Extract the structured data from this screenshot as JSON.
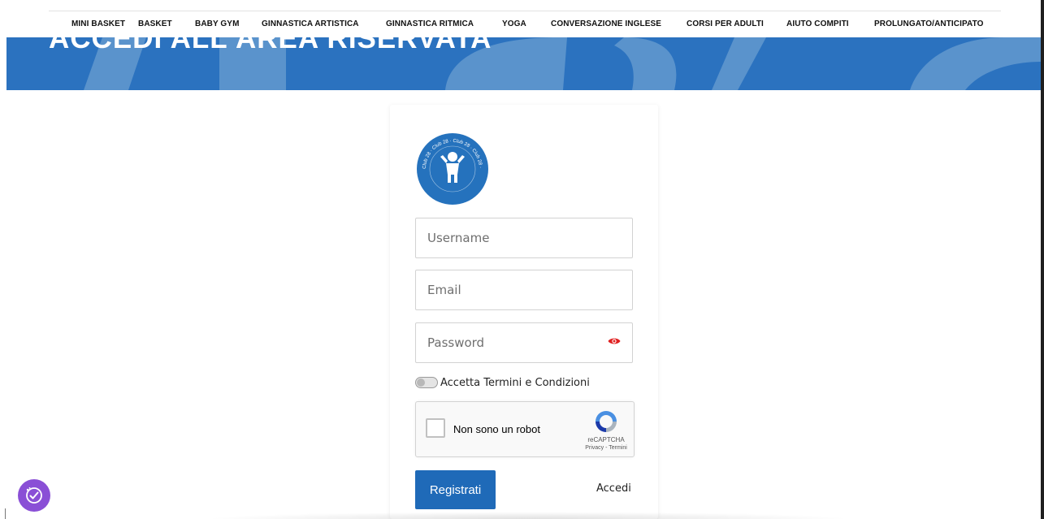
{
  "nav": {
    "items": [
      "MINI BASKET",
      "BASKET",
      "BABY GYM",
      "GINNASTICA ARTISTICA",
      "GINNASTICA RITMICA",
      "YOGA",
      "CONVERSAZIONE INGLESE",
      "CORSI PER ADULTI",
      "AIUTO COMPITI",
      "PROLUNGATO/ANTICIPATO"
    ]
  },
  "hero": {
    "title": "ACCEDI ALL'AREA RISERVATA",
    "color": "#2b72bf"
  },
  "logo": {
    "text": "Club 28",
    "color": "#2572bd"
  },
  "form": {
    "username_placeholder": "Username",
    "email_placeholder": "Email",
    "password_placeholder": "Password",
    "terms_label": "Accetta Termini e Condizioni",
    "captcha": {
      "label": "Non sono un robot",
      "brand": "reCAPTCHA",
      "links": "Privacy - Termini"
    },
    "register_label": "Registrati",
    "login_label": "Accedi",
    "accent_color": "#1f6ab8",
    "eye_icon_color": "#e02020"
  },
  "accessibility": {
    "icon": "accessibility-icon",
    "color": "#8a4fd6"
  }
}
